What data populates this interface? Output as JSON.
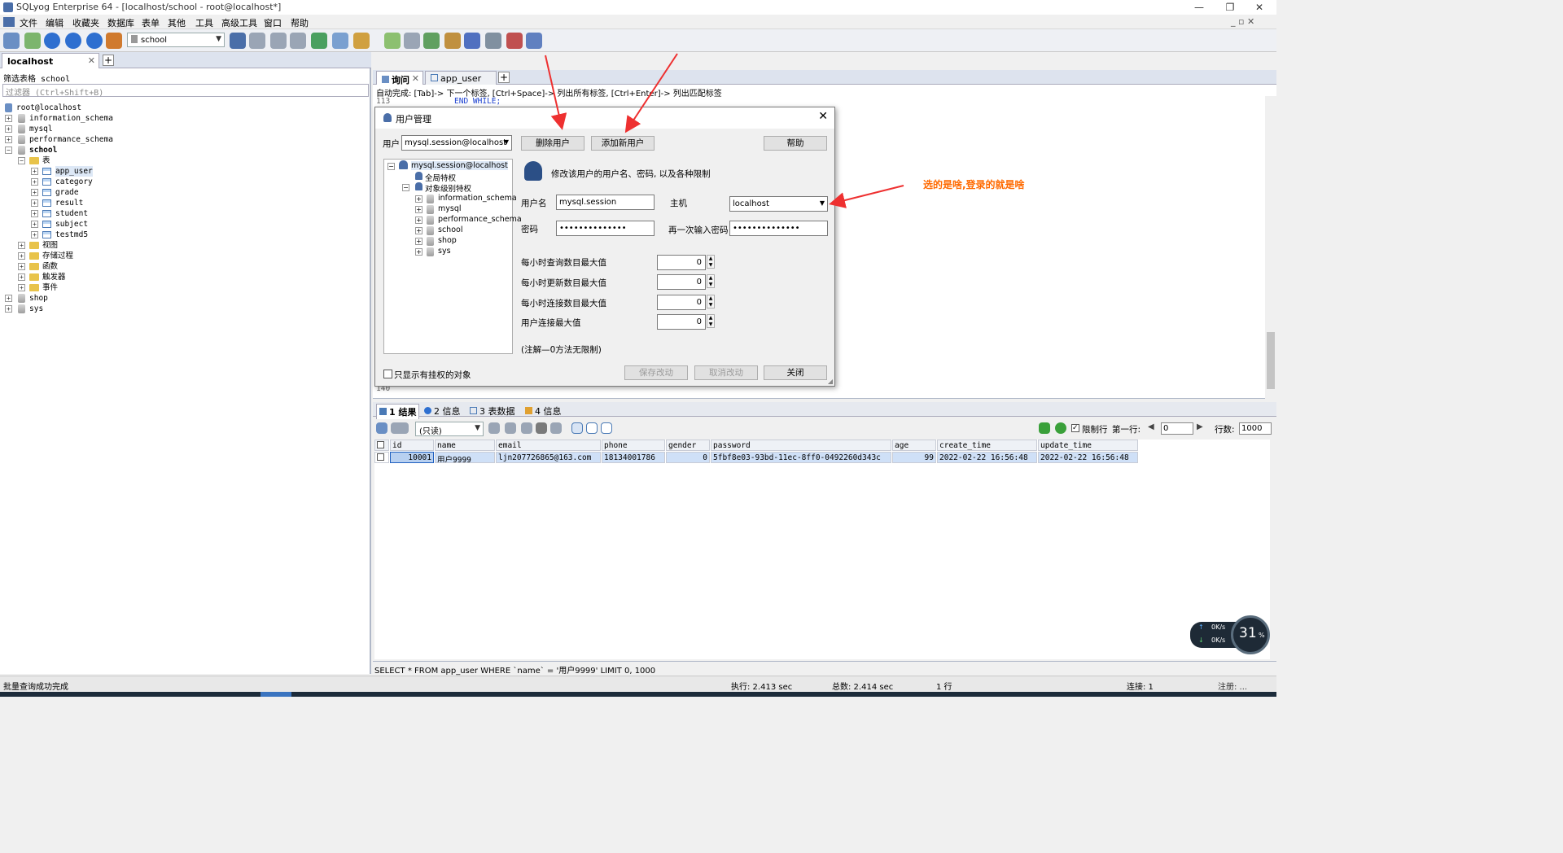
{
  "window": {
    "title": "SQLyog Enterprise 64 - [localhost/school - root@localhost*]"
  },
  "menu": [
    "文件",
    "编辑",
    "收藏夹",
    "数据库",
    "表单",
    "其他",
    "工具",
    "高级工具",
    "窗口",
    "帮助"
  ],
  "toolbar": {
    "db_selector": "school"
  },
  "connection_tab": {
    "label": "localhost"
  },
  "left_panel": {
    "filter_label": "筛选表格 school",
    "filter_placeholder": "过滤器 (Ctrl+Shift+B)",
    "tree": {
      "root": "root@localhost",
      "dbs": [
        "information_schema",
        "mysql",
        "performance_schema",
        "school"
      ],
      "school_folder_tables": "表",
      "tables": [
        "app_user",
        "category",
        "grade",
        "result",
        "student",
        "subject",
        "testmd5"
      ],
      "folders": [
        "视图",
        "存储过程",
        "函数",
        "触发器",
        "事件"
      ],
      "other_dbs": [
        "shop",
        "sys"
      ]
    }
  },
  "query_tabs": [
    "询问",
    "app_user"
  ],
  "editor": {
    "hint": "自动完成: [Tab]-> 下一个标签, [Ctrl+Space]-> 列出所有标签, [Ctrl+Enter]-> 列出匹配标签",
    "line_113": "113",
    "line_113_code": "END WHILE;",
    "line_140": "140"
  },
  "dialog": {
    "title": "用户管理",
    "user_label": "用户",
    "user_value": "mysql.session@localhost",
    "btn_delete": "删除用户",
    "btn_add": "添加新用户",
    "btn_help": "帮助",
    "tree_root": "mysql.session@localhost",
    "tree_global": "全局特权",
    "tree_object": "对象级别特权",
    "tree_dbs": [
      "information_schema",
      "mysql",
      "performance_schema",
      "school",
      "shop",
      "sys"
    ],
    "desc": "修改该用户的用户名、密码, 以及各种限制",
    "username_label": "用户名",
    "username_value": "mysql.session",
    "host_label": "主机",
    "host_value": "localhost",
    "password_label": "密码",
    "password_value": "••••••••••••••",
    "repass_label": "再一次输入密码",
    "repass_value": "••••••••••••••",
    "limits": [
      {
        "label": "每小时查询数目最大值",
        "value": "0"
      },
      {
        "label": "每小时更新数目最大值",
        "value": "0"
      },
      {
        "label": "每小时连接数目最大值",
        "value": "0"
      },
      {
        "label": "用户连接最大值",
        "value": "0"
      }
    ],
    "note": "(注解—0方法无限制)",
    "show_privileged": "只显示有挂权的对象",
    "btn_save": "保存改动",
    "btn_cancel": "取消改动",
    "btn_close": "关闭"
  },
  "annotation": {
    "text": "选的是啥,登录的就是啥"
  },
  "result_tabs": [
    "1 结果",
    "2 信息",
    "3 表数据",
    "4 信息"
  ],
  "result_toolbar": {
    "mode": "(只读)",
    "limit_rows": "限制行",
    "first_row_label": "第一行:",
    "first_row_value": "0",
    "row_count_label": "行数:",
    "row_count_value": "1000"
  },
  "grid": {
    "columns": [
      "id",
      "name",
      "email",
      "phone",
      "gender",
      "password",
      "age",
      "create_time",
      "update_time"
    ],
    "rows": [
      [
        "10001",
        "用户9999",
        "ljn207726865@163.com",
        "18134001786",
        "0",
        "5fbf8e03-93bd-11ec-8ff0-0492260d343c",
        "99",
        "2022-02-22 16:56:48",
        "2022-02-22 16:56:48"
      ]
    ]
  },
  "sql_line": "SELECT * FROM app_user WHERE `name` = '用户9999' LIMIT 0, 1000",
  "status": {
    "left": "批量查询成功完成",
    "exec": "执行: 2.413 sec",
    "total": "总数: 2.414 sec",
    "rows": "1 行",
    "conn": "连接: 1",
    "reg": "注册: ..."
  },
  "net_widget": {
    "up": "0K/s",
    "down": "0K/s",
    "cpu": "31"
  }
}
